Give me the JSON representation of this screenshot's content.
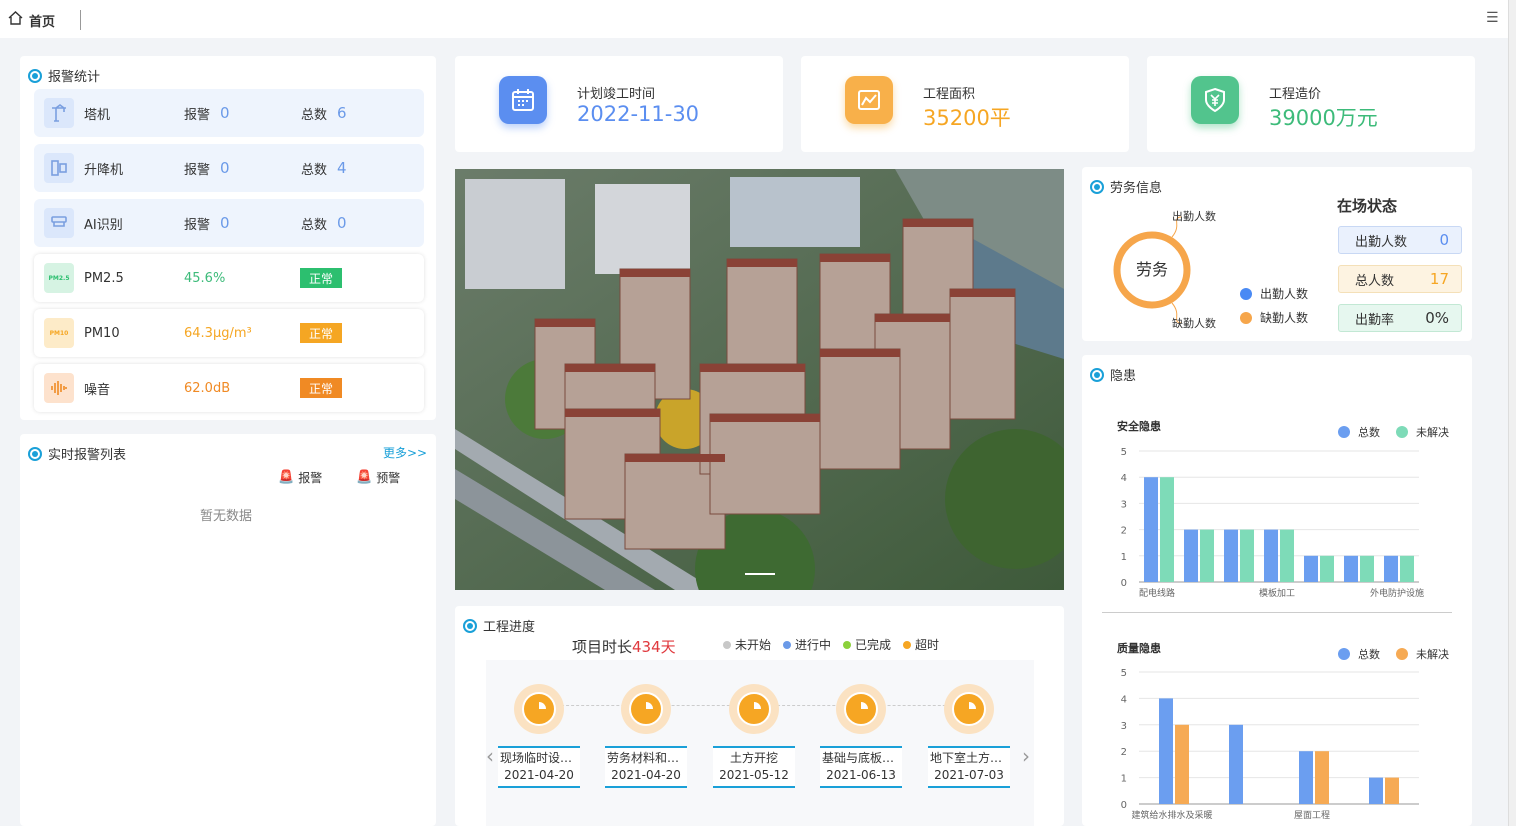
{
  "topbar": {
    "home_tab": "首页",
    "home_icon": "home-icon",
    "menu_icon": "hamburger-menu-icon"
  },
  "alarm_stats": {
    "title": "报警统计",
    "devices": [
      {
        "name": "塔机",
        "alarm_label": "报警",
        "alarm": "0",
        "total_label": "总数",
        "total": "6",
        "icon": "tower-crane-icon"
      },
      {
        "name": "升降机",
        "alarm_label": "报警",
        "alarm": "0",
        "total_label": "总数",
        "total": "4",
        "icon": "elevator-icon"
      },
      {
        "name": "AI识别",
        "alarm_label": "报警",
        "alarm": "0",
        "total_label": "总数",
        "total": "0",
        "icon": "camera-icon"
      }
    ],
    "environment": [
      {
        "name": "PM2.5",
        "value": "45.6%",
        "status": "正常",
        "value_color": "#3dbb7a",
        "badge_color": "#2cbf6f",
        "icon": "pm25-icon",
        "icon_text": "PM2.5"
      },
      {
        "name": "PM10",
        "value": "64.3μg/m³",
        "status": "正常",
        "value_color": "#f5a623",
        "badge_color": "#f5a623",
        "icon": "pm10-icon",
        "icon_text": "PM10"
      },
      {
        "name": "噪音",
        "value": "62.0dB",
        "status": "正常",
        "value_color": "#f08a24",
        "badge_color": "#f08a24",
        "icon": "sound-wave-icon"
      }
    ]
  },
  "realtime_alarms": {
    "title": "实时报警列表",
    "more": "更多>>",
    "legend_alarm": "报警",
    "legend_warning": "预警",
    "empty": "暂无数据"
  },
  "stats": [
    {
      "label": "计划竣工时间",
      "value": "2022-11-30",
      "color": "#5b8ef0",
      "icon": "calendar-icon"
    },
    {
      "label": "工程面积",
      "value": "35200平",
      "color": "#f6a623",
      "icon": "area-chart-icon"
    },
    {
      "label": "工程造价",
      "value": "39000万元",
      "color": "#3dbb7a",
      "icon": "yuan-shield-icon"
    }
  ],
  "carousel": {
    "image": "building-aerial-rendering"
  },
  "progress": {
    "title": "工程进度",
    "duration_prefix": "项目时长",
    "duration_value": "434天",
    "legend": [
      {
        "label": "未开始",
        "color": "#c8c8c8"
      },
      {
        "label": "进行中",
        "color": "#6b9ae8"
      },
      {
        "label": "已完成",
        "color": "#8bd13b"
      },
      {
        "label": "超时",
        "color": "#f6a623"
      }
    ],
    "milestones": [
      {
        "name": "现场临时设施搭建",
        "date": "2021-04-20"
      },
      {
        "name": "劳务材料和设备进场",
        "date": "2021-04-20"
      },
      {
        "name": "土方开挖",
        "date": "2021-05-12"
      },
      {
        "name": "基础与底板施工",
        "date": "2021-06-13"
      },
      {
        "name": "地下室土方回填",
        "date": "2021-07-03"
      }
    ]
  },
  "labor": {
    "title": "劳务信息",
    "donut_label": "劳务",
    "pointer_top": "出勤人数",
    "pointer_bottom": "缺勤人数",
    "legend": [
      {
        "label": "出勤人数",
        "color": "#4a8af4"
      },
      {
        "label": "缺勤人数",
        "color": "#f6a64b"
      }
    ],
    "onsite_title": "在场状态",
    "status": [
      {
        "label": "出勤人数",
        "value": "0",
        "bg": "#eaf1fd",
        "border": "#c8d8f4",
        "color": "#5b8ef0"
      },
      {
        "label": "总人数",
        "value": "17",
        "bg": "#fdf3e1",
        "border": "#f4e0b8",
        "color": "#f6a623"
      },
      {
        "label": "出勤率",
        "value": "0%",
        "bg": "#e6f7ef",
        "border": "#c2e8d4",
        "color": "#333333"
      }
    ]
  },
  "hazards": {
    "title": "隐患",
    "colors": {
      "total": "#6b9ef0",
      "unresolved_safety": "#7edbb8",
      "unresolved_quality": "#f6aa54"
    }
  },
  "chart_data": [
    {
      "type": "bar",
      "title": "安全隐患",
      "categories": [
        "配电线路",
        "",
        "模板加工",
        "",
        "",
        "外电防护设施"
      ],
      "series": [
        {
          "name": "总数",
          "values": [
            4,
            2,
            2,
            2,
            1,
            1,
            1
          ]
        },
        {
          "name": "未解决",
          "values": [
            4,
            2,
            2,
            2,
            1,
            1,
            1
          ]
        }
      ],
      "ylim": [
        0,
        5
      ],
      "yticks": [
        "0",
        "1",
        "2",
        "3",
        "4",
        "5"
      ],
      "xtick_labels": [
        "配电线路",
        "模板加工",
        "外电防护设施"
      ],
      "legend": "top-right",
      "grid": true
    },
    {
      "type": "bar",
      "title": "质量隐患",
      "categories": [
        "建筑给水排水及采暖",
        "",
        "屋面工程",
        ""
      ],
      "series": [
        {
          "name": "总数",
          "values": [
            4,
            3,
            2,
            1
          ]
        },
        {
          "name": "未解决",
          "values": [
            3,
            0,
            2,
            1
          ]
        }
      ],
      "ylim": [
        0,
        5
      ],
      "yticks": [
        "0",
        "1",
        "2",
        "3",
        "4",
        "5"
      ],
      "xtick_labels": [
        "建筑给水排水及采暖",
        "屋面工程"
      ],
      "legend": "top-right",
      "grid": true
    }
  ]
}
